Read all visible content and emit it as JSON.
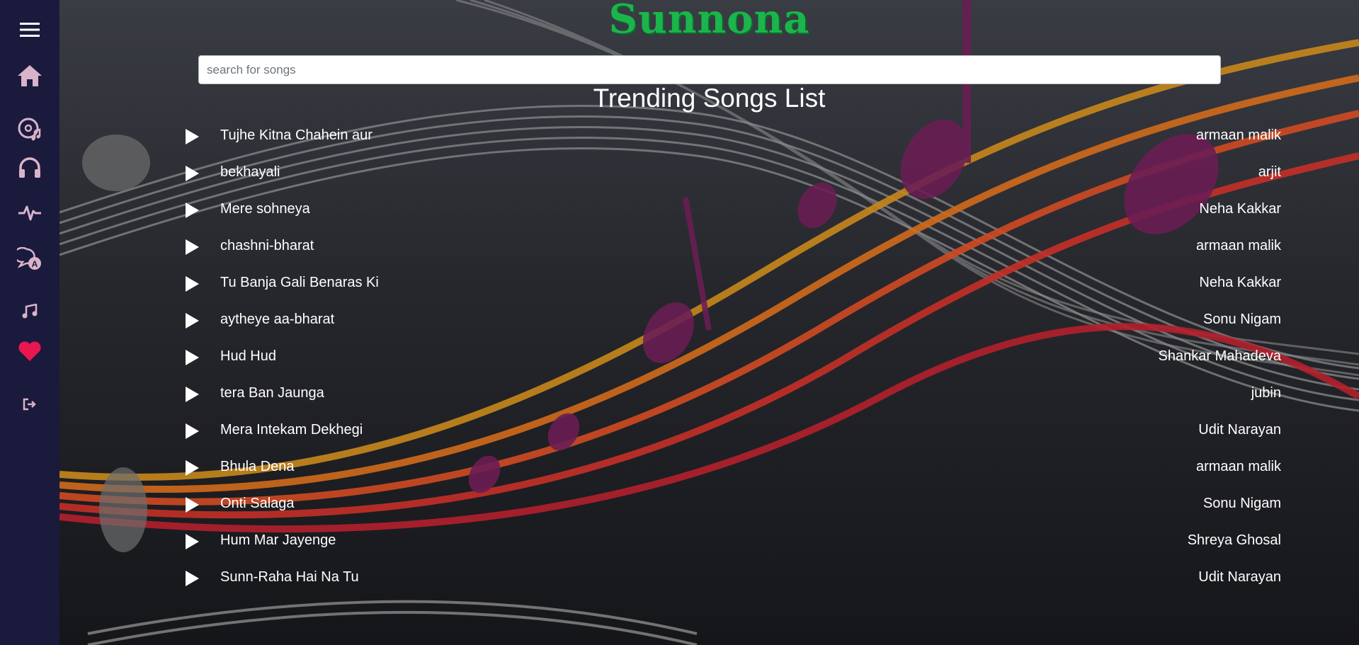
{
  "app": {
    "brand": "Sunnona"
  },
  "search": {
    "placeholder": "search for songs",
    "value": ""
  },
  "main": {
    "heading": "Trending Songs List"
  },
  "sidebar": {
    "items": [
      {
        "name": "menu-icon"
      },
      {
        "name": "home-icon"
      },
      {
        "name": "music-disc-icon"
      },
      {
        "name": "headphones-icon"
      },
      {
        "name": "pulse-icon"
      },
      {
        "name": "chat-icon"
      },
      {
        "name": "music-note-icon"
      },
      {
        "name": "heart-icon",
        "color": "#e8174f"
      },
      {
        "name": "logout-icon"
      }
    ],
    "icon_color": "#d9b3c9",
    "background": "#1a1a3d"
  },
  "colors": {
    "brand": "#1bb54b",
    "heart": "#e8174f"
  },
  "songs": [
    {
      "title": "Tujhe Kitna Chahein aur",
      "artist": "armaan malik"
    },
    {
      "title": "bekhayali",
      "artist": "arjit"
    },
    {
      "title": "Mere sohneya",
      "artist": "Neha Kakkar"
    },
    {
      "title": "chashni-bharat",
      "artist": "armaan malik"
    },
    {
      "title": "Tu Banja Gali Benaras Ki",
      "artist": "Neha Kakkar"
    },
    {
      "title": "aytheye aa-bharat",
      "artist": "Sonu Nigam"
    },
    {
      "title": "Hud Hud",
      "artist": "Shankar Mahadeva"
    },
    {
      "title": "tera Ban Jaunga",
      "artist": "jubin"
    },
    {
      "title": "Mera Intekam Dekhegi",
      "artist": "Udit Narayan"
    },
    {
      "title": "Bhula Dena",
      "artist": "armaan malik"
    },
    {
      "title": "Onti Salaga",
      "artist": "Sonu Nigam"
    },
    {
      "title": "Hum Mar Jayenge",
      "artist": "Shreya Ghosal"
    },
    {
      "title": "Sunn-Raha Hai Na Tu",
      "artist": "Udit Narayan"
    }
  ]
}
